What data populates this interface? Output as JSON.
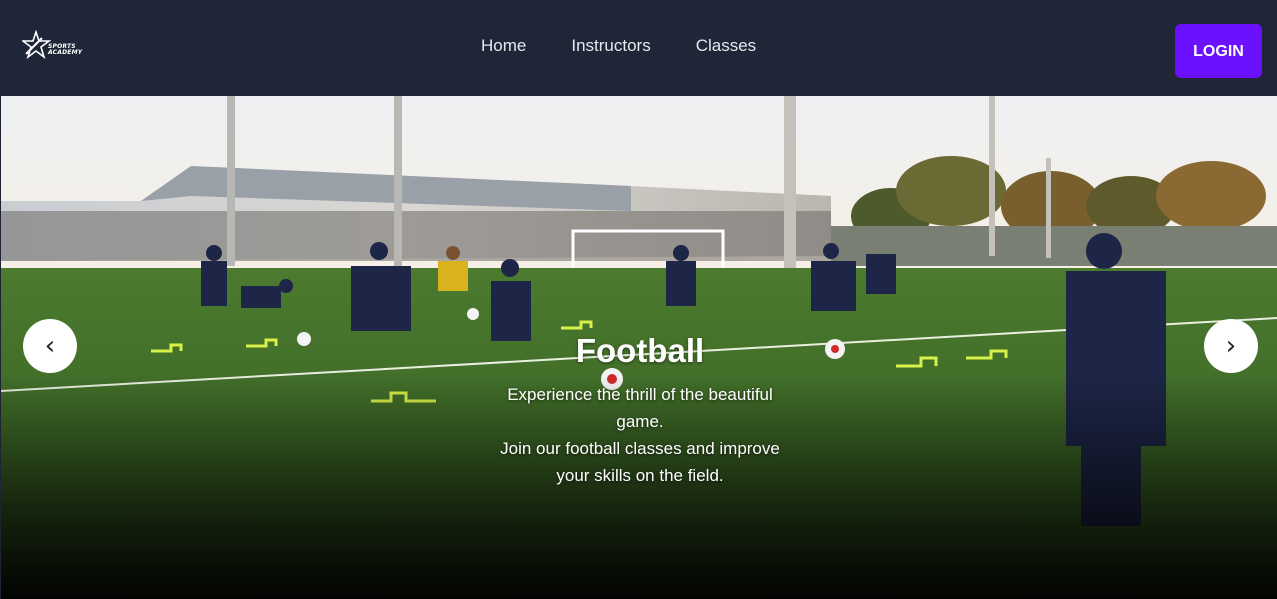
{
  "brand": {
    "logo_icon": "star-runner-logo",
    "logo_line1": "SPORTS",
    "logo_line2": "ACADEMY"
  },
  "nav": {
    "items": [
      {
        "label": "Home"
      },
      {
        "label": "Instructors"
      },
      {
        "label": "Classes"
      }
    ],
    "login_label": "LOGIN"
  },
  "slider": {
    "prev_label": "‹",
    "next_label": "›",
    "prev_icon": "chevron-left-icon",
    "next_icon": "chevron-right-icon",
    "current": {
      "title": "Football",
      "description_line1": "Experience the thrill of the beautiful game.",
      "description_line2": "Join our football classes and improve your skills on the field."
    }
  },
  "colors": {
    "navbar_bg": "#1f2637",
    "login_bg": "#6b11ff",
    "text": "#ffffff"
  }
}
